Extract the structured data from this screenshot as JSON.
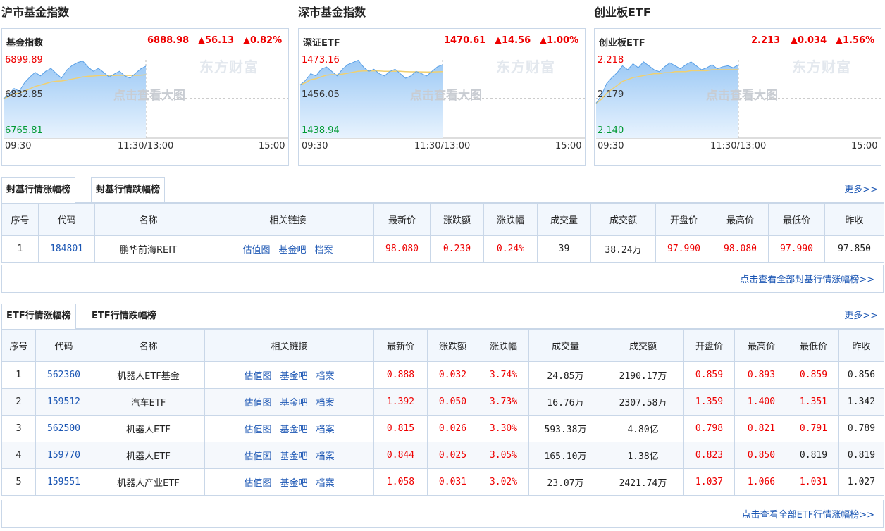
{
  "panels": [
    {
      "title": "沪市基金指数",
      "name": "基金指数",
      "price": "6888.98",
      "change": "▲56.13",
      "pct": "▲0.82%",
      "high": "6899.89",
      "mid": "6832.85",
      "low": "6765.81",
      "t_start": "09:30",
      "t_mid": "11:30/13:00",
      "t_end": "15:00",
      "watermark": "东方财富",
      "hint": "点击查看大图",
      "series": [
        6832,
        6840,
        6850,
        6845,
        6860,
        6870,
        6878,
        6872,
        6880,
        6885,
        6876,
        6868,
        6882,
        6890,
        6895,
        6898,
        6888,
        6880,
        6885,
        6878,
        6870,
        6875,
        6880,
        6872,
        6868,
        6876,
        6884,
        6889
      ]
    },
    {
      "title": "深市基金指数",
      "name": "深证ETF",
      "price": "1470.61",
      "change": "▲14.56",
      "pct": "▲1.00%",
      "high": "1473.16",
      "mid": "1456.05",
      "low": "1438.94",
      "t_start": "09:30",
      "t_mid": "11:30/13:00",
      "t_end": "15:00",
      "watermark": "东方财富",
      "hint": "点击查看大图",
      "series": [
        1462,
        1464,
        1467,
        1466,
        1469,
        1470,
        1468,
        1466,
        1469,
        1471,
        1472,
        1473,
        1470,
        1468,
        1469,
        1467,
        1466,
        1468,
        1469,
        1467,
        1465,
        1466,
        1468,
        1467,
        1466,
        1468,
        1470,
        1471
      ]
    },
    {
      "title": "创业板ETF",
      "name": "创业板ETF",
      "price": "2.213",
      "change": "▲0.034",
      "pct": "▲1.56%",
      "high": "2.218",
      "mid": "2.179",
      "low": "2.140",
      "t_start": "09:30",
      "t_mid": "11:30/13:00",
      "t_end": "15:00",
      "watermark": "东方财富",
      "hint": "点击查看大图",
      "series": [
        2.174,
        2.182,
        2.194,
        2.2,
        2.205,
        2.212,
        2.208,
        2.214,
        2.21,
        2.216,
        2.212,
        2.208,
        2.206,
        2.211,
        2.215,
        2.212,
        2.209,
        2.213,
        2.216,
        2.212,
        2.208,
        2.21,
        2.213,
        2.209,
        2.211,
        2.212,
        2.21,
        2.213
      ],
      "avg": [
        2.174,
        2.178,
        2.184,
        2.188,
        2.192,
        2.196,
        2.198,
        2.2,
        2.201,
        2.202,
        2.203,
        2.204,
        2.204,
        2.205,
        2.205,
        2.206,
        2.206,
        2.206,
        2.207,
        2.207,
        2.207,
        2.207,
        2.208,
        2.208,
        2.208,
        2.208,
        2.208,
        2.208
      ]
    }
  ],
  "closed_end": {
    "tab_up": "封基行情涨幅榜",
    "tab_down": "封基行情跌幅榜",
    "more": "更多>>",
    "headers": [
      "序号",
      "代码",
      "名称",
      "相关链接",
      "最新价",
      "涨跌额",
      "涨跌幅",
      "成交量",
      "成交额",
      "开盘价",
      "最高价",
      "最低价",
      "昨收"
    ],
    "rows": [
      [
        "1",
        "184801",
        "鹏华前海REIT",
        "98.080",
        "0.230",
        "0.24%",
        "39",
        "38.24万",
        "97.990",
        "98.080",
        "97.990",
        "97.850"
      ]
    ],
    "footer": "点击查看全部封基行情涨幅榜>>"
  },
  "etf": {
    "tab_up": "ETF行情涨幅榜",
    "tab_down": "ETF行情跌幅榜",
    "more": "更多>>",
    "headers": [
      "序号",
      "代码",
      "名称",
      "相关链接",
      "最新价",
      "涨跌额",
      "涨跌幅",
      "成交量",
      "成交额",
      "开盘价",
      "最高价",
      "最低价",
      "昨收"
    ],
    "rows": [
      [
        "1",
        "562360",
        "机器人ETF基金",
        "0.888",
        "0.032",
        "3.74%",
        "24.85万",
        "2190.17万",
        "0.859",
        "0.893",
        "0.859",
        "0.856"
      ],
      [
        "2",
        "159512",
        "汽车ETF",
        "1.392",
        "0.050",
        "3.73%",
        "16.76万",
        "2307.58万",
        "1.359",
        "1.400",
        "1.351",
        "1.342"
      ],
      [
        "3",
        "562500",
        "机器人ETF",
        "0.815",
        "0.026",
        "3.30%",
        "593.38万",
        "4.80亿",
        "0.798",
        "0.821",
        "0.791",
        "0.789"
      ],
      [
        "4",
        "159770",
        "机器人ETF",
        "0.844",
        "0.025",
        "3.05%",
        "165.10万",
        "1.38亿",
        "0.823",
        "0.850",
        "0.819",
        "0.819"
      ],
      [
        "5",
        "159551",
        "机器人产业ETF",
        "1.058",
        "0.031",
        "3.02%",
        "23.07万",
        "2421.74万",
        "1.037",
        "1.066",
        "1.031",
        "1.027"
      ]
    ],
    "footer": "点击查看全部ETF行情涨幅榜>>"
  },
  "links": [
    "估值图",
    "基金吧",
    "档案"
  ],
  "colors": {
    "up": "#e00000",
    "link": "#1a55b3",
    "border": "#c9d7e8",
    "header_bg": "#f2f7fd",
    "chart_line": "#5aa0e6",
    "avg_line": "#f0d070"
  }
}
